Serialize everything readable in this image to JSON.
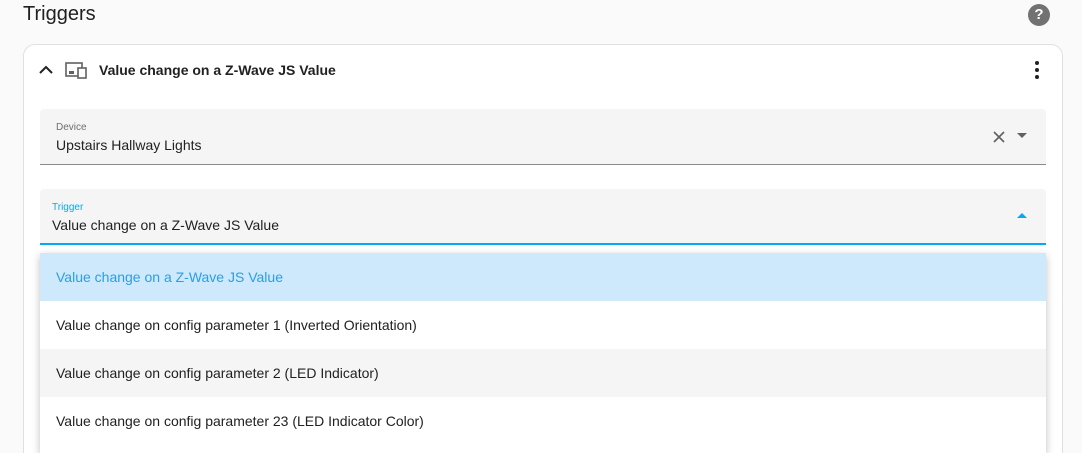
{
  "section": {
    "title": "Triggers",
    "help_icon": "help-circle-icon"
  },
  "card": {
    "title": "Value change on a Z-Wave JS Value",
    "collapse_icon": "chevron-up-icon",
    "device_icon": "devices-icon",
    "menu_icon": "more-vertical-icon"
  },
  "device_field": {
    "label": "Device",
    "value": "Upstairs Hallway Lights"
  },
  "trigger_field": {
    "label": "Trigger",
    "value": "Value change on a Z-Wave JS Value"
  },
  "trigger_options": [
    {
      "label": "Value change on a Z-Wave JS Value",
      "state": "selected"
    },
    {
      "label": "Value change on config parameter 1 (Inverted Orientation)",
      "state": "normal"
    },
    {
      "label": "Value change on config parameter 2 (LED Indicator)",
      "state": "hover"
    },
    {
      "label": "Value change on config parameter 23 (LED Indicator Color)",
      "state": "normal"
    }
  ],
  "colors": {
    "accent": "#03a9f4",
    "selected_bg": "#cde9fb"
  }
}
